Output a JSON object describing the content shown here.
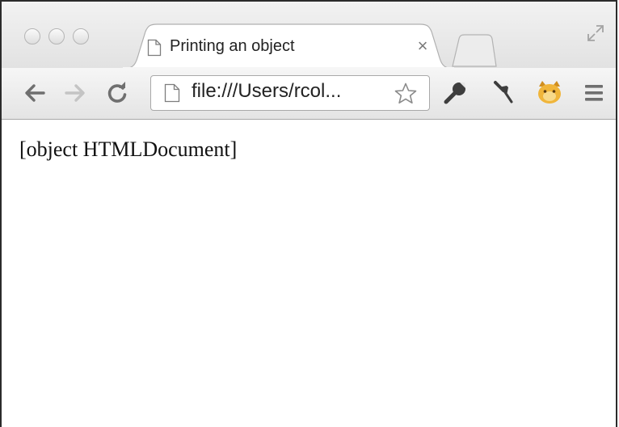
{
  "browser": {
    "tab": {
      "title": "Printing an object",
      "close_glyph": "×",
      "favicon": "page-icon"
    },
    "address_bar": {
      "url": "file:///Users/rcol...",
      "page_icon": "page-icon",
      "bookmark_icon": "star-icon"
    },
    "toolbar_icons": [
      "back-arrow-icon",
      "forward-arrow-icon",
      "reload-icon",
      "wrench-icon",
      "pin-icon",
      "extension-cat-icon",
      "menu-icon"
    ],
    "window_controls": [
      "close-circle",
      "minimize-circle",
      "zoom-circle"
    ]
  },
  "page": {
    "body_text": "[object HTMLDocument]"
  },
  "colors": {
    "chrome_gradient_top": "#f2f2f2",
    "chrome_gradient_bottom": "#e2e2e2",
    "extension_icon": "#f0b53a"
  }
}
